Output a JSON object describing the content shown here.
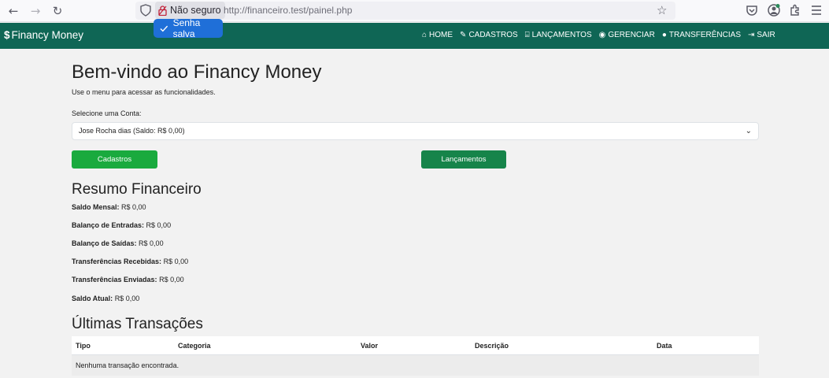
{
  "browser": {
    "security_label": "Não seguro",
    "url": "http://financeiro.test/painel.php",
    "tooltip": "Senha salva",
    "icons": [
      "back-icon",
      "forward-icon",
      "reload-icon",
      "shield-icon",
      "lock-warning-icon",
      "star-icon",
      "pocket-icon",
      "account-icon",
      "extensions-icon",
      "menu-icon"
    ]
  },
  "navbar": {
    "brand": "Financy Money",
    "items": [
      {
        "icon": "home-icon",
        "label": "HOME"
      },
      {
        "icon": "edit-icon",
        "label": "CADASTROS"
      },
      {
        "icon": "bank-icon",
        "label": "LANÇAMENTOS"
      },
      {
        "icon": "eye-icon",
        "label": "GERENCIAR"
      },
      {
        "icon": "comment-icon",
        "label": "TRANSFERÊNCIAS"
      },
      {
        "icon": "signout-icon",
        "label": "SAIR"
      }
    ],
    "color": "#0f6655"
  },
  "main": {
    "title": "Bem-vindo ao Financy Money",
    "subtitle": "Use o menu para acessar as funcionalidades.",
    "select_label": "Selecione uma Conta:",
    "select_value": "Jose Rocha dias (Saldo: R$ 0,00)",
    "btn_cadastros": "Cadastros",
    "btn_lancamentos": "Lançamentos"
  },
  "resumo": {
    "title": "Resumo Financeiro",
    "items": [
      {
        "label": "Saldo Mensal:",
        "value": "R$ 0,00"
      },
      {
        "label": "Balanço de Entradas:",
        "value": "R$ 0,00"
      },
      {
        "label": "Balanço de Saídas:",
        "value": "R$ 0,00"
      },
      {
        "label": "Transferências Recebidas:",
        "value": "R$ 0,00"
      },
      {
        "label": "Transferências Enviadas:",
        "value": "R$ 0,00"
      },
      {
        "label": "Saldo Atual:",
        "value": "R$ 0,00"
      }
    ]
  },
  "transacoes": {
    "title": "Últimas Transações",
    "columns": [
      "Tipo",
      "Categoria",
      "Valor",
      "Descrição",
      "Data"
    ],
    "empty": "Nenhuma transação encontrada."
  }
}
